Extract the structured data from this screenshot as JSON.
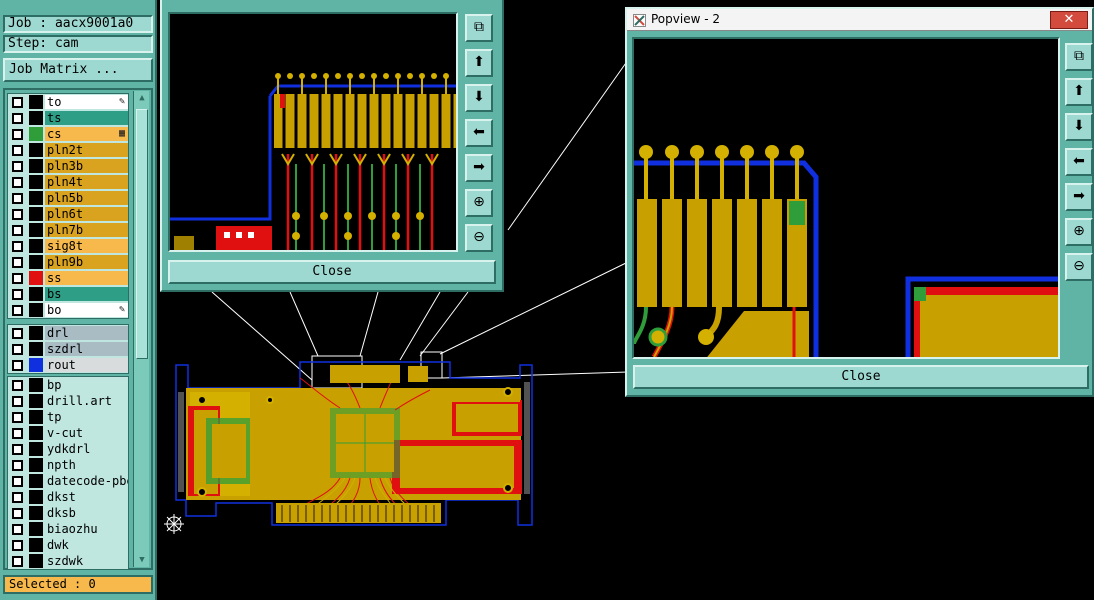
{
  "job_panel": {
    "job_label": "Job : aacx9001a0",
    "step_label": "Step: cam",
    "job_matrix_button": "Job Matrix ...",
    "selected_label": "Selected : 0",
    "layer_groups": [
      {
        "layers": [
          {
            "name": "to",
            "name_bg": "#ffffff",
            "swatch": "#000000",
            "flag": "✎"
          },
          {
            "name": "ts",
            "name_bg": "#2f9e86",
            "swatch": "#000000",
            "flag": ""
          },
          {
            "name": "cs",
            "name_bg": "#f7b84c",
            "swatch": "#2f9e3a",
            "flag": "▦"
          },
          {
            "name": "pln2t",
            "name_bg": "#d9a21f",
            "swatch": "#000000",
            "flag": ""
          },
          {
            "name": "pln3b",
            "name_bg": "#d9a21f",
            "swatch": "#000000",
            "flag": ""
          },
          {
            "name": "pln4t",
            "name_bg": "#d9a21f",
            "swatch": "#000000",
            "flag": ""
          },
          {
            "name": "pln5b",
            "name_bg": "#d9a21f",
            "swatch": "#000000",
            "flag": ""
          },
          {
            "name": "pln6t",
            "name_bg": "#d9a21f",
            "swatch": "#000000",
            "flag": ""
          },
          {
            "name": "pln7b",
            "name_bg": "#d9a21f",
            "swatch": "#000000",
            "flag": ""
          },
          {
            "name": "sig8t",
            "name_bg": "#f7b84c",
            "swatch": "#000000",
            "flag": ""
          },
          {
            "name": "pln9b",
            "name_bg": "#d9a21f",
            "swatch": "#000000",
            "flag": ""
          },
          {
            "name": "ss",
            "name_bg": "#f7b84c",
            "swatch": "#e01010",
            "flag": ""
          },
          {
            "name": "bs",
            "name_bg": "#2f9e86",
            "swatch": "#000000",
            "flag": ""
          },
          {
            "name": "bo",
            "name_bg": "#ffffff",
            "swatch": "#000000",
            "flag": "✎"
          }
        ]
      },
      {
        "layers": [
          {
            "name": "drl",
            "name_bg": "#a9bcc4",
            "swatch": "#000000",
            "flag": ""
          },
          {
            "name": "szdrl",
            "name_bg": "#a9bcc4",
            "swatch": "#000000",
            "flag": ""
          },
          {
            "name": "rout",
            "name_bg": "#d9dcdc",
            "swatch": "#1030e0",
            "flag": ""
          }
        ]
      },
      {
        "layers": [
          {
            "name": "bp",
            "name_bg": "#bfe7e0",
            "swatch": "#000000",
            "flag": ""
          },
          {
            "name": "drill.art",
            "name_bg": "#bfe7e0",
            "swatch": "#000000",
            "flag": ""
          },
          {
            "name": "tp",
            "name_bg": "#bfe7e0",
            "swatch": "#000000",
            "flag": ""
          },
          {
            "name": "v-cut",
            "name_bg": "#bfe7e0",
            "swatch": "#000000",
            "flag": ""
          },
          {
            "name": "ydkdrl",
            "name_bg": "#bfe7e0",
            "swatch": "#000000",
            "flag": ""
          },
          {
            "name": "npth",
            "name_bg": "#bfe7e0",
            "swatch": "#000000",
            "flag": ""
          },
          {
            "name": "datecode-pbe",
            "name_bg": "#bfe7e0",
            "swatch": "#000000",
            "flag": ""
          },
          {
            "name": "dkst",
            "name_bg": "#bfe7e0",
            "swatch": "#000000",
            "flag": ""
          },
          {
            "name": "dksb",
            "name_bg": "#bfe7e0",
            "swatch": "#000000",
            "flag": ""
          },
          {
            "name": "biaozhu",
            "name_bg": "#bfe7e0",
            "swatch": "#000000",
            "flag": ""
          },
          {
            "name": "dwk",
            "name_bg": "#bfe7e0",
            "swatch": "#000000",
            "flag": ""
          },
          {
            "name": "szdwk",
            "name_bg": "#bfe7e0",
            "swatch": "#000000",
            "flag": ""
          }
        ]
      }
    ]
  },
  "popview1": {
    "close_button": "Close",
    "tools": [
      "fit-icon",
      "pan-up-icon",
      "pan-down-icon",
      "pan-left-icon",
      "pan-right-icon",
      "zoom-in-icon",
      "zoom-out-icon"
    ]
  },
  "popview2": {
    "title": "Popview - 2",
    "close_button": "Close",
    "tools": [
      "fit-icon",
      "pan-up-icon",
      "pan-down-icon",
      "pan-left-icon",
      "pan-right-icon",
      "zoom-in-icon",
      "zoom-out-icon"
    ]
  },
  "colors": {
    "panel_bg": "#5fb4a6",
    "copper": "#c8a000",
    "trace_red": "#e01010",
    "trace_green": "#2f9e3a",
    "outline_blue": "#1030e0",
    "gold_pad": "#d4b000"
  }
}
